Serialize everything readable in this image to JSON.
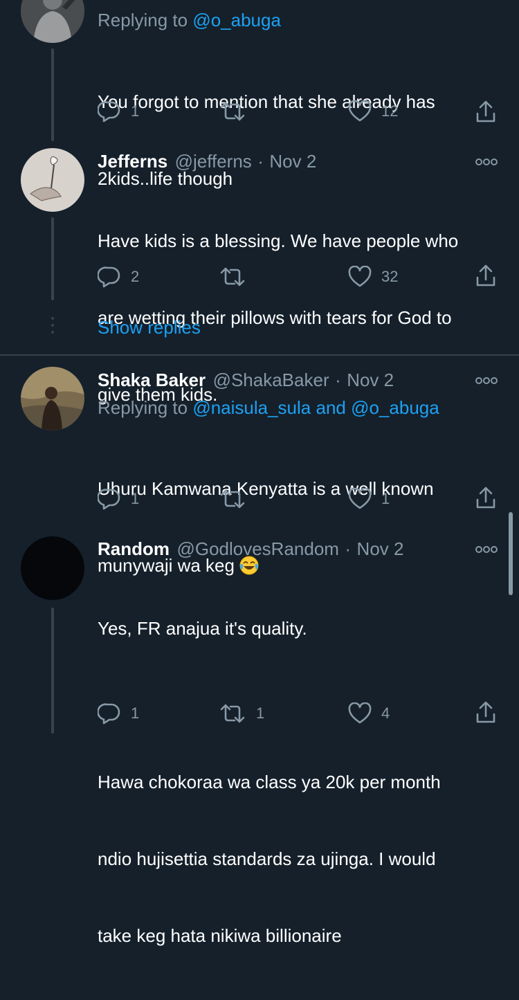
{
  "tweets": [
    {
      "reply_prefix": "Replying to ",
      "reply_handles": "@o_abuga",
      "text_lines": [
        "You forgot to mention that she already has",
        "2kids..life though"
      ],
      "reply_count": "1",
      "retweet_count": "",
      "like_count": "12"
    },
    {
      "name": "Jefferns",
      "handle": "@jefferns",
      "dot": "·",
      "date": "Nov 2",
      "text_lines": [
        "Have kids is a blessing. We have people who",
        "are wetting their pillows with tears for God to",
        "give them kids."
      ],
      "reply_count": "2",
      "retweet_count": "",
      "like_count": "32"
    },
    {
      "name": "Shaka Baker",
      "handle": "@ShakaBaker",
      "dot": "·",
      "date": "Nov 2",
      "reply_prefix": "Replying to ",
      "reply_handles": "@naisula_sula and @o_abuga",
      "text_lines": [
        "Uhuru Kamwana Kenyatta is a well known",
        "munywaji wa keg"
      ],
      "emoji": "face-with-tears-of-joy",
      "reply_count": "1",
      "retweet_count": "",
      "like_count": "1"
    },
    {
      "name": "Random",
      "handle": "@GodlovesRandom",
      "dot": "·",
      "date": "Nov 2",
      "text_lines": [
        "Yes, FR anajua it's quality.",
        "",
        "Hawa chokoraa wa class ya 20k per month",
        "ndio hujisettia standards za ujinga. I would",
        "take keg hata nikiwa billionaire"
      ],
      "reply_count": "1",
      "retweet_count": "1",
      "like_count": "4"
    }
  ],
  "show_replies_label": "Show replies",
  "colors": {
    "background": "#15202b",
    "secondary_text": "#8899a6",
    "link": "#1da1f2",
    "divider": "#38444d"
  },
  "icons": [
    "reply-icon",
    "retweet-icon",
    "like-icon",
    "share-icon",
    "more-icon"
  ]
}
